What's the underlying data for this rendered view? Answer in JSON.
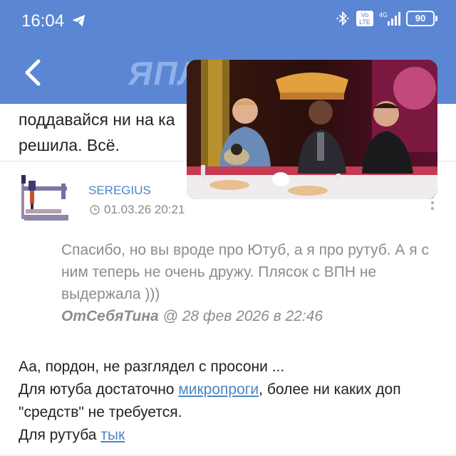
{
  "status_bar": {
    "time": "16:04",
    "network": "4G",
    "volte": "Vo LTE",
    "battery": "90"
  },
  "header": {
    "logo_text": "ЯПЛ"
  },
  "previous_post": {
    "line1": "поддавайся ни на ка",
    "line2": "решила. Всё."
  },
  "post": {
    "author": "SEREGIUS",
    "date": "01.03.26 20:21",
    "quote": {
      "text": "Спасибо, но вы вроде про Ютуб, а я про рутуб. А я с ним теперь не очень дружу. Плясок с ВПН не выдержала )))",
      "author": "ОтСебяТина",
      "meta": "@ 28 фев 2026 в 22:46"
    },
    "reply": {
      "line1": "Аа, пордон, не разглядел с просони ...",
      "line2_before": "Для ютуба достаточно ",
      "line2_link": "микропроги",
      "line2_after": ", более ни каких доп \"средств\" не требуется.",
      "line3_before": "Для рутуба ",
      "line3_link": "тык"
    }
  },
  "colors": {
    "header": "#5b86d4",
    "link": "#4a86c8",
    "quote": "#8c8c8c"
  },
  "icons": [
    "telegram-icon",
    "bluetooth-icon",
    "signal-icon",
    "battery-icon",
    "back-arrow-icon",
    "clock-icon",
    "more-vertical-icon"
  ]
}
